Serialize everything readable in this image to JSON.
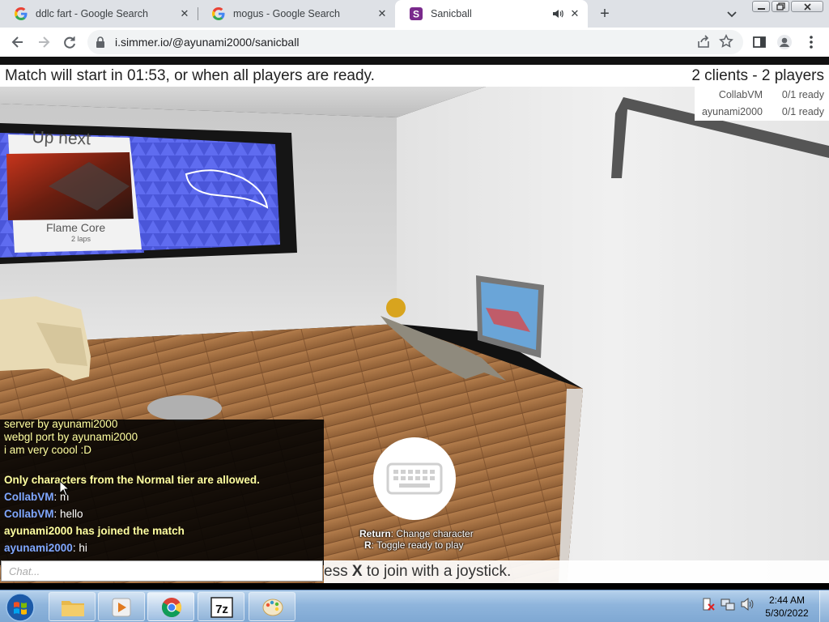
{
  "browser": {
    "tabs": [
      {
        "title": "ddlc fart - Google Search",
        "icon": "google-icon"
      },
      {
        "title": "mogus - Google Search",
        "icon": "google-icon"
      },
      {
        "title": "Sanicball",
        "icon": "sanicball-icon",
        "active": true
      }
    ],
    "url": "i.simmer.io/@ayunami2000/sanicball"
  },
  "game": {
    "status": "Match will start in 01:53, or when all players are ready.",
    "clients": "2 clients - 2 players",
    "players": [
      {
        "name": "CollabVM",
        "ready": "0/1 ready"
      },
      {
        "name": "ayunami2000",
        "ready": "0/1 ready"
      }
    ],
    "up_next": {
      "title": "Up next",
      "map": "Flame Core",
      "laps": "2 laps"
    },
    "chat": {
      "lines": [
        {
          "type": "system",
          "text": "server by ayunami2000"
        },
        {
          "type": "system",
          "text": "webgl port by ayunami2000"
        },
        {
          "type": "system",
          "text": "i am very coool :D"
        },
        {
          "type": "system-bold",
          "text": "Only characters from the Normal tier are allowed."
        },
        {
          "type": "user",
          "name": "CollabVM",
          "sep": ":",
          "text": " m"
        },
        {
          "type": "user",
          "name": "CollabVM",
          "sep": ":",
          "text": " hello"
        },
        {
          "type": "system-bold",
          "text": "ayunami2000 has joined the match"
        },
        {
          "type": "user",
          "name": "ayunami2000",
          "sep": ":",
          "text": " hi"
        }
      ],
      "placeholder": "Chat..."
    },
    "joystick": {
      "pre": "ess ",
      "key": "X",
      "post": " to join with a joystick."
    },
    "hints": {
      "return_key": "Return",
      "return_text": ": Change character",
      "r_key": "R",
      "r_text": ": Toggle ready to play"
    }
  },
  "taskbar": {
    "apps": [
      "windows-explorer-icon",
      "media-player-icon",
      "chrome-icon",
      "7zip-icon",
      "paint-icon"
    ],
    "clock": {
      "time": "2:44 AM",
      "date": "5/30/2022"
    }
  }
}
